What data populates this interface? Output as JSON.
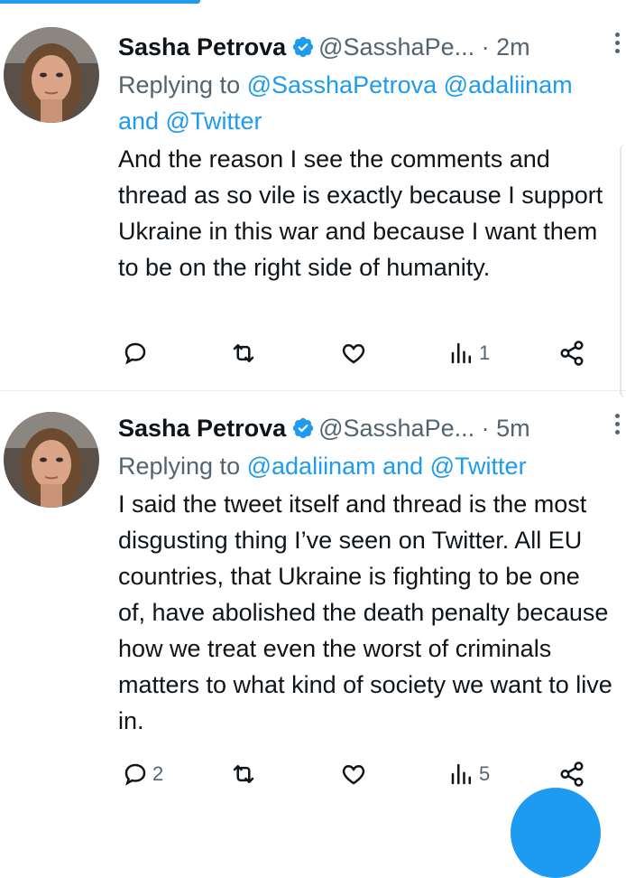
{
  "colors": {
    "accent": "#1d9bf0",
    "muted": "#536471",
    "text": "#0f1419"
  },
  "tweets": [
    {
      "name": "Sasha Petrova",
      "verified": true,
      "handle": "@SasshaPe...",
      "separator": "·",
      "time": "2m",
      "reply_prefix": "Replying to",
      "reply_mentions": "@SasshaPetrova @adaliinam and @Twitter",
      "text": "And the reason I see the comments and thread as so vile is exactly because I support Ukraine in this war and because I want them to be on the right side of humanity.",
      "actions": {
        "reply_count": "",
        "retweet_count": "",
        "like_count": "",
        "views_count": "1"
      }
    },
    {
      "name": "Sasha Petrova",
      "verified": true,
      "handle": "@SasshaPe...",
      "separator": "·",
      "time": "5m",
      "reply_prefix": "Replying to",
      "reply_mentions": "@adaliinam and @Twitter",
      "text": "I said the tweet itself and thread is the most disgusting thing I’ve seen on Twitter. All EU countries, that Ukraine is fighting to be one of, have abolished the death penalty because how we treat even the worst of criminals matters to what kind of society we want to live in.",
      "actions": {
        "reply_count": "2",
        "retweet_count": "",
        "like_count": "",
        "views_count": "5"
      }
    }
  ],
  "icons": [
    "avatar",
    "verified-badge-icon",
    "more-options-icon",
    "reply-icon",
    "retweet-icon",
    "like-icon",
    "views-icon",
    "share-icon",
    "compose-fab"
  ]
}
